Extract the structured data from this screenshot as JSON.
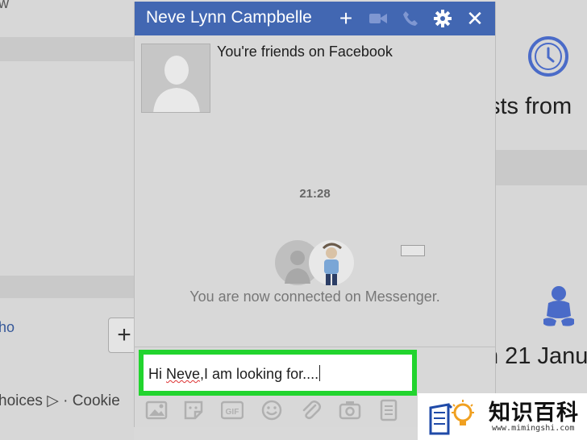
{
  "background": {
    "left_fragments": {
      "top": "w",
      "middle": "ho",
      "bottom": "hoices ▷ · Cookie"
    },
    "right_fragments": {
      "line1": "sts from",
      "line2": "n 21 Janu"
    },
    "plus_button": "+"
  },
  "chat": {
    "title": "Neve Lynn Campbelle",
    "header_icons": [
      "plus-icon",
      "video-icon",
      "phone-icon",
      "gear-icon",
      "close-icon"
    ],
    "plus_glyph": "+",
    "close_glyph": "✕",
    "friends_text": "You're friends on Facebook",
    "timestamp": "21:28",
    "connected_text": "You are now connected on Messenger.",
    "input": {
      "prefix": "Hi ",
      "misspelled": "Neve",
      "suffix": ",I am looking for...."
    },
    "toolbar_icons": [
      "photo-icon",
      "sticker-icon",
      "gif-icon",
      "emoji-icon",
      "attachment-icon",
      "camera-icon",
      "document-icon"
    ],
    "gif_label": "GIF"
  },
  "watermark": {
    "title": "知识百科",
    "url": "www.mimingshi.com"
  },
  "colors": {
    "header": "#4267b2",
    "highlight": "#22d42e",
    "accent": "#4a6bc8"
  }
}
